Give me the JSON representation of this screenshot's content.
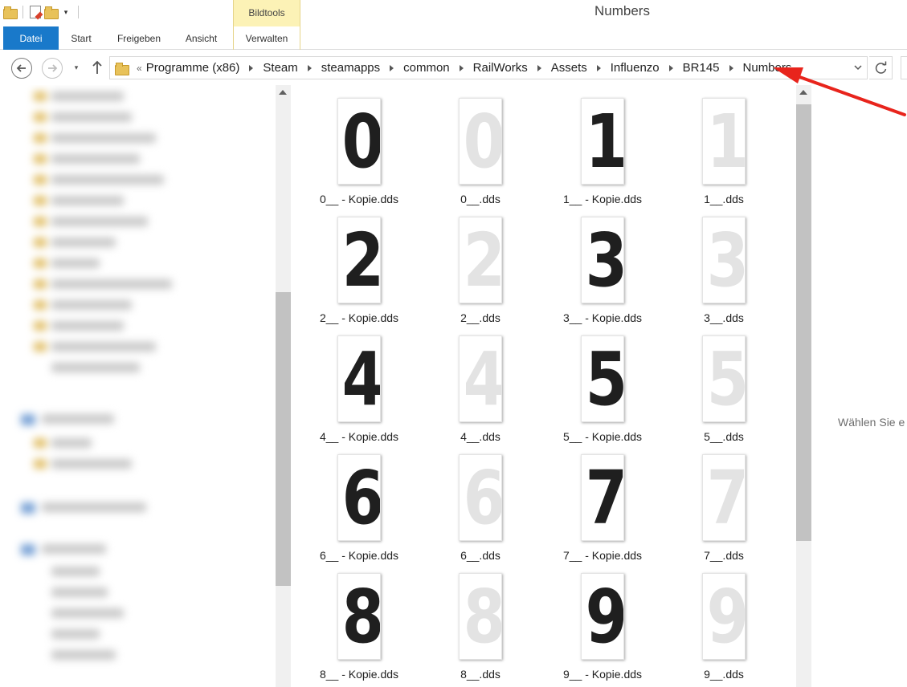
{
  "window": {
    "title": "Numbers"
  },
  "quick_access": {
    "icons": [
      "folder-icon",
      "properties-icon",
      "new-folder-icon",
      "customize-dropdown-icon"
    ]
  },
  "ribbon": {
    "contextual_group": "Bildtools",
    "tabs": [
      {
        "label": "Datei",
        "active": true
      },
      {
        "label": "Start"
      },
      {
        "label": "Freigeben"
      },
      {
        "label": "Ansicht"
      },
      {
        "label": "Verwalten"
      }
    ]
  },
  "address": {
    "overflow_glyph": "«",
    "crumbs": [
      "Programme (x86)",
      "Steam",
      "steamapps",
      "common",
      "RailWorks",
      "Assets",
      "Influenzo",
      "BR145",
      "Numbers"
    ]
  },
  "files": [
    {
      "name": "0__ - Kopie.dds",
      "digit": "0",
      "style": "dark"
    },
    {
      "name": "0__.dds",
      "digit": "0",
      "style": "light"
    },
    {
      "name": "1__ - Kopie.dds",
      "digit": "1",
      "style": "dark"
    },
    {
      "name": "1__.dds",
      "digit": "1",
      "style": "light"
    },
    {
      "name": "2__ - Kopie.dds",
      "digit": "2",
      "style": "dark"
    },
    {
      "name": "2__.dds",
      "digit": "2",
      "style": "light"
    },
    {
      "name": "3__ - Kopie.dds",
      "digit": "3",
      "style": "dark"
    },
    {
      "name": "3__.dds",
      "digit": "3",
      "style": "light"
    },
    {
      "name": "4__ - Kopie.dds",
      "digit": "4",
      "style": "dark"
    },
    {
      "name": "4__.dds",
      "digit": "4",
      "style": "light"
    },
    {
      "name": "5__ - Kopie.dds",
      "digit": "5",
      "style": "dark"
    },
    {
      "name": "5__.dds",
      "digit": "5",
      "style": "light"
    },
    {
      "name": "6__ - Kopie.dds",
      "digit": "6",
      "style": "dark"
    },
    {
      "name": "6__.dds",
      "digit": "6",
      "style": "light"
    },
    {
      "name": "7__ - Kopie.dds",
      "digit": "7",
      "style": "dark"
    },
    {
      "name": "7__.dds",
      "digit": "7",
      "style": "light"
    },
    {
      "name": "8__ - Kopie.dds",
      "digit": "8",
      "style": "dark"
    },
    {
      "name": "8__.dds",
      "digit": "8",
      "style": "light"
    },
    {
      "name": "9__ - Kopie.dds",
      "digit": "9",
      "style": "dark"
    },
    {
      "name": "9__.dds",
      "digit": "9",
      "style": "light"
    }
  ],
  "preview": {
    "text": "Wählen Sie e"
  },
  "colors": {
    "accent": "#1979ca",
    "contextual_tab": "#fcf2b6",
    "annotation": "#e8241c"
  }
}
